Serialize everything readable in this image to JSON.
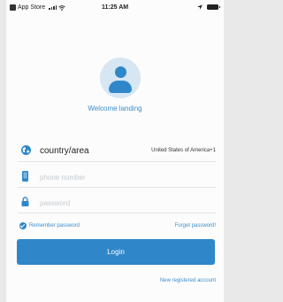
{
  "status_bar": {
    "carrier": "App Store",
    "time": "11:25 AM"
  },
  "welcome_text": "Welcome landing",
  "country": {
    "label": "country/area",
    "value": "United States of America+1"
  },
  "phone": {
    "placeholder": "phone number",
    "value": ""
  },
  "password": {
    "placeholder": "password",
    "value": ""
  },
  "remember": {
    "label": "Remember password",
    "checked": true
  },
  "forgot_label": "Forget password!",
  "login_label": "Login",
  "register_label": "New registered account",
  "icons": {
    "globe": "globe-icon",
    "phone": "phone-icon",
    "lock": "lock-icon",
    "avatar": "user-avatar-icon"
  },
  "colors": {
    "accent": "#2f87c9",
    "text_link": "#3b8dca",
    "placeholder": "#c5cbd0"
  }
}
